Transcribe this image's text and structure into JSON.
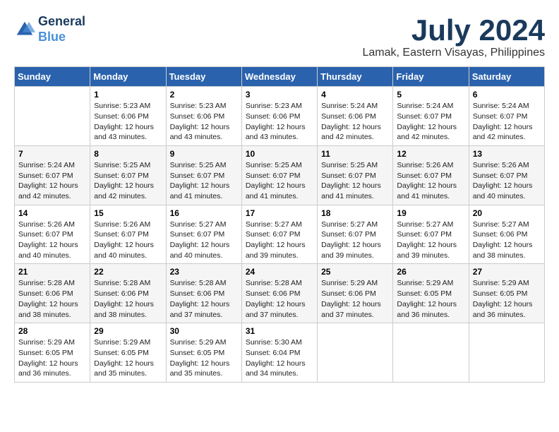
{
  "header": {
    "logo_line1": "General",
    "logo_line2": "Blue",
    "month_year": "July 2024",
    "location": "Lamak, Eastern Visayas, Philippines"
  },
  "days_of_week": [
    "Sunday",
    "Monday",
    "Tuesday",
    "Wednesday",
    "Thursday",
    "Friday",
    "Saturday"
  ],
  "weeks": [
    [
      {
        "day": "",
        "text": ""
      },
      {
        "day": "1",
        "text": "Sunrise: 5:23 AM\nSunset: 6:06 PM\nDaylight: 12 hours\nand 43 minutes."
      },
      {
        "day": "2",
        "text": "Sunrise: 5:23 AM\nSunset: 6:06 PM\nDaylight: 12 hours\nand 43 minutes."
      },
      {
        "day": "3",
        "text": "Sunrise: 5:23 AM\nSunset: 6:06 PM\nDaylight: 12 hours\nand 43 minutes."
      },
      {
        "day": "4",
        "text": "Sunrise: 5:24 AM\nSunset: 6:06 PM\nDaylight: 12 hours\nand 42 minutes."
      },
      {
        "day": "5",
        "text": "Sunrise: 5:24 AM\nSunset: 6:07 PM\nDaylight: 12 hours\nand 42 minutes."
      },
      {
        "day": "6",
        "text": "Sunrise: 5:24 AM\nSunset: 6:07 PM\nDaylight: 12 hours\nand 42 minutes."
      }
    ],
    [
      {
        "day": "7",
        "text": "Sunrise: 5:24 AM\nSunset: 6:07 PM\nDaylight: 12 hours\nand 42 minutes."
      },
      {
        "day": "8",
        "text": "Sunrise: 5:25 AM\nSunset: 6:07 PM\nDaylight: 12 hours\nand 42 minutes."
      },
      {
        "day": "9",
        "text": "Sunrise: 5:25 AM\nSunset: 6:07 PM\nDaylight: 12 hours\nand 41 minutes."
      },
      {
        "day": "10",
        "text": "Sunrise: 5:25 AM\nSunset: 6:07 PM\nDaylight: 12 hours\nand 41 minutes."
      },
      {
        "day": "11",
        "text": "Sunrise: 5:25 AM\nSunset: 6:07 PM\nDaylight: 12 hours\nand 41 minutes."
      },
      {
        "day": "12",
        "text": "Sunrise: 5:26 AM\nSunset: 6:07 PM\nDaylight: 12 hours\nand 41 minutes."
      },
      {
        "day": "13",
        "text": "Sunrise: 5:26 AM\nSunset: 6:07 PM\nDaylight: 12 hours\nand 40 minutes."
      }
    ],
    [
      {
        "day": "14",
        "text": "Sunrise: 5:26 AM\nSunset: 6:07 PM\nDaylight: 12 hours\nand 40 minutes."
      },
      {
        "day": "15",
        "text": "Sunrise: 5:26 AM\nSunset: 6:07 PM\nDaylight: 12 hours\nand 40 minutes."
      },
      {
        "day": "16",
        "text": "Sunrise: 5:27 AM\nSunset: 6:07 PM\nDaylight: 12 hours\nand 40 minutes."
      },
      {
        "day": "17",
        "text": "Sunrise: 5:27 AM\nSunset: 6:07 PM\nDaylight: 12 hours\nand 39 minutes."
      },
      {
        "day": "18",
        "text": "Sunrise: 5:27 AM\nSunset: 6:07 PM\nDaylight: 12 hours\nand 39 minutes."
      },
      {
        "day": "19",
        "text": "Sunrise: 5:27 AM\nSunset: 6:07 PM\nDaylight: 12 hours\nand 39 minutes."
      },
      {
        "day": "20",
        "text": "Sunrise: 5:27 AM\nSunset: 6:06 PM\nDaylight: 12 hours\nand 38 minutes."
      }
    ],
    [
      {
        "day": "21",
        "text": "Sunrise: 5:28 AM\nSunset: 6:06 PM\nDaylight: 12 hours\nand 38 minutes."
      },
      {
        "day": "22",
        "text": "Sunrise: 5:28 AM\nSunset: 6:06 PM\nDaylight: 12 hours\nand 38 minutes."
      },
      {
        "day": "23",
        "text": "Sunrise: 5:28 AM\nSunset: 6:06 PM\nDaylight: 12 hours\nand 37 minutes."
      },
      {
        "day": "24",
        "text": "Sunrise: 5:28 AM\nSunset: 6:06 PM\nDaylight: 12 hours\nand 37 minutes."
      },
      {
        "day": "25",
        "text": "Sunrise: 5:29 AM\nSunset: 6:06 PM\nDaylight: 12 hours\nand 37 minutes."
      },
      {
        "day": "26",
        "text": "Sunrise: 5:29 AM\nSunset: 6:05 PM\nDaylight: 12 hours\nand 36 minutes."
      },
      {
        "day": "27",
        "text": "Sunrise: 5:29 AM\nSunset: 6:05 PM\nDaylight: 12 hours\nand 36 minutes."
      }
    ],
    [
      {
        "day": "28",
        "text": "Sunrise: 5:29 AM\nSunset: 6:05 PM\nDaylight: 12 hours\nand 36 minutes."
      },
      {
        "day": "29",
        "text": "Sunrise: 5:29 AM\nSunset: 6:05 PM\nDaylight: 12 hours\nand 35 minutes."
      },
      {
        "day": "30",
        "text": "Sunrise: 5:29 AM\nSunset: 6:05 PM\nDaylight: 12 hours\nand 35 minutes."
      },
      {
        "day": "31",
        "text": "Sunrise: 5:30 AM\nSunset: 6:04 PM\nDaylight: 12 hours\nand 34 minutes."
      },
      {
        "day": "",
        "text": ""
      },
      {
        "day": "",
        "text": ""
      },
      {
        "day": "",
        "text": ""
      }
    ]
  ]
}
